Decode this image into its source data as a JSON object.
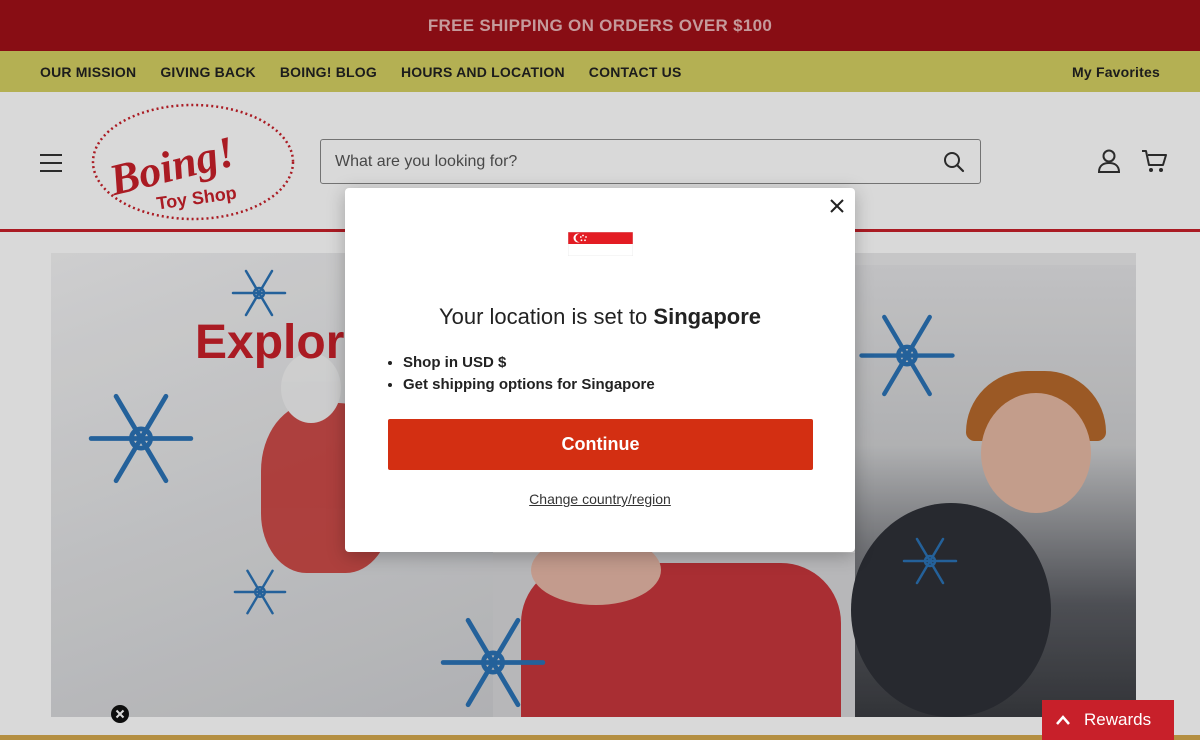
{
  "announcement": "FREE SHIPPING ON ORDERS OVER $100",
  "nav": {
    "links": [
      "OUR MISSION",
      "GIVING BACK",
      "BOING! BLOG",
      "HOURS AND LOCATION",
      "CONTACT US"
    ],
    "favorites": "My Favorites"
  },
  "header": {
    "logo_text": "Boing!",
    "logo_subtext": "Toy Shop",
    "search_placeholder": "What are you looking for?",
    "account_icon": "user-icon",
    "cart_icon": "cart-icon",
    "menu_icon": "hamburger-icon"
  },
  "hero": {
    "title_partial": "Explor"
  },
  "modal": {
    "heading_prefix": "Your location is set to ",
    "country": "Singapore",
    "bullets": [
      "Shop in USD $",
      "Get shipping options for Singapore"
    ],
    "continue_label": "Continue",
    "change_label": "Change country/region",
    "flag_icon": "singapore-flag-icon"
  },
  "rewards": {
    "label": "Rewards"
  },
  "colors": {
    "brand_red": "#a01018",
    "nav_yellow": "#d4cf62",
    "button_red": "#d32f12",
    "snowflake_blue": "#2b73b5"
  }
}
